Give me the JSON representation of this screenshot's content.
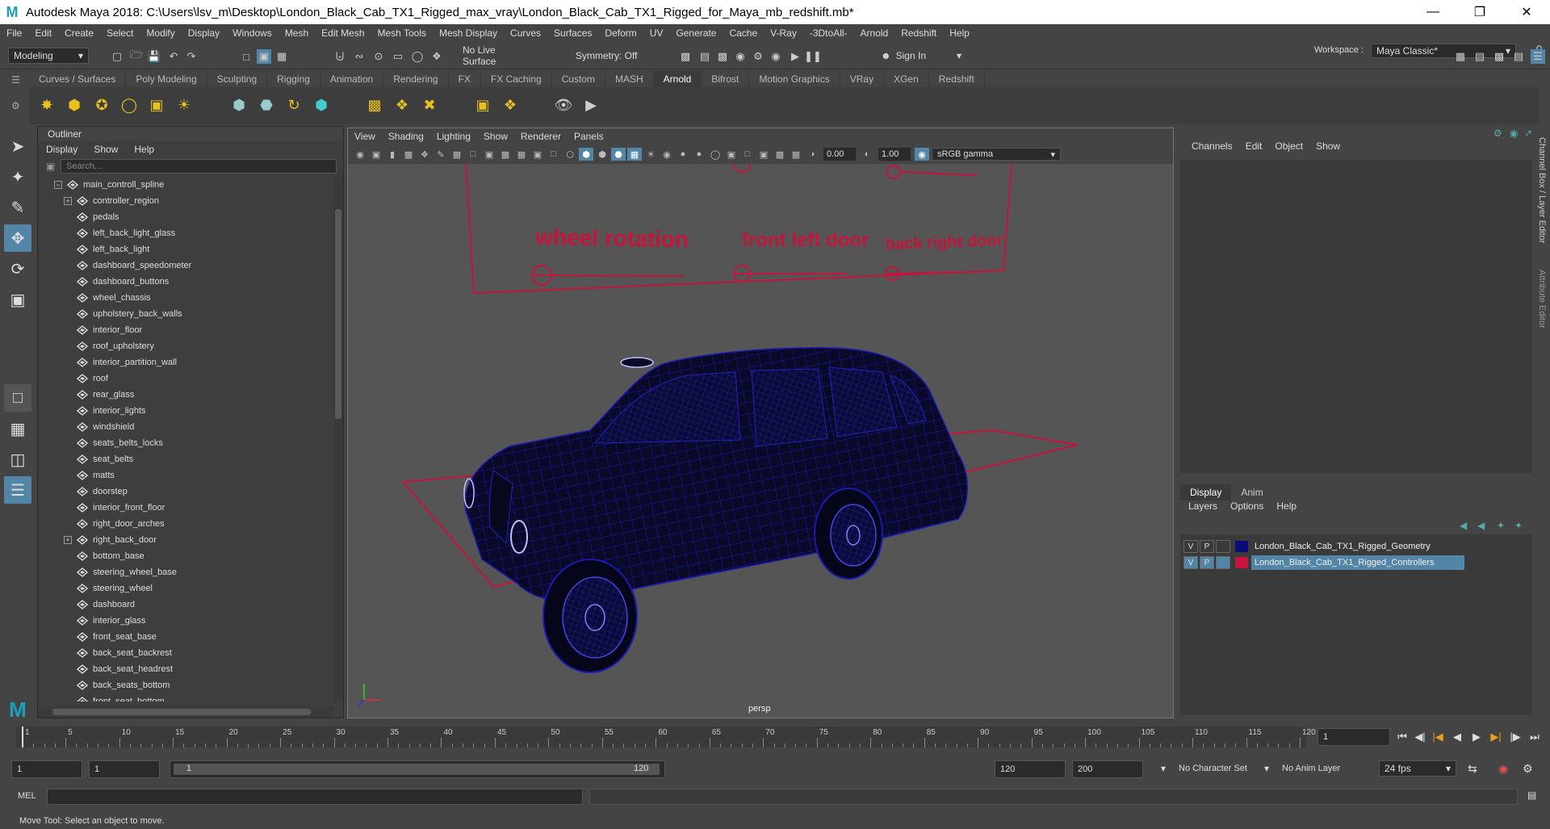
{
  "title": "Autodesk Maya 2018: C:\\Users\\lsv_m\\Desktop\\London_Black_Cab_TX1_Rigged_max_vray\\London_Black_Cab_TX1_Rigged_for_Maya_mb_redshift.mb*",
  "menus": [
    "File",
    "Edit",
    "Create",
    "Select",
    "Modify",
    "Display",
    "Windows",
    "Mesh",
    "Edit Mesh",
    "Mesh Tools",
    "Mesh Display",
    "Curves",
    "Surfaces",
    "Deform",
    "UV",
    "Generate",
    "Cache",
    "V-Ray",
    "-3DtoAll-",
    "Arnold",
    "Redshift",
    "Help"
  ],
  "status": {
    "mode": "Modeling",
    "live_surface": "No Live Surface",
    "symmetry": "Symmetry: Off",
    "sign_in": "Sign In",
    "workspace_label": "Workspace :",
    "workspace": "Maya Classic*"
  },
  "shelf_tabs": [
    {
      "label": "Curves / Surfaces",
      "active": false
    },
    {
      "label": "Poly Modeling",
      "active": false
    },
    {
      "label": "Sculpting",
      "active": false
    },
    {
      "label": "Rigging",
      "active": false
    },
    {
      "label": "Animation",
      "active": false
    },
    {
      "label": "Rendering",
      "active": false
    },
    {
      "label": "FX",
      "active": false
    },
    {
      "label": "FX Caching",
      "active": false
    },
    {
      "label": "Custom",
      "active": false
    },
    {
      "label": "MASH",
      "active": false
    },
    {
      "label": "Arnold",
      "active": true
    },
    {
      "label": "Bifrost",
      "active": false
    },
    {
      "label": "Motion Graphics",
      "active": false
    },
    {
      "label": "VRay",
      "active": false
    },
    {
      "label": "XGen",
      "active": false
    },
    {
      "label": "Redshift",
      "active": false
    }
  ],
  "outliner": {
    "title": "Outliner",
    "menu": [
      "Display",
      "Show",
      "Help"
    ],
    "search_placeholder": "Search...",
    "items": [
      {
        "label": "main_controll_spline",
        "expand": "minus",
        "indent": 0
      },
      {
        "label": "controller_region",
        "expand": "plus",
        "indent": 1
      },
      {
        "label": "pedals",
        "expand": "",
        "indent": 1
      },
      {
        "label": "left_back_light_glass",
        "expand": "",
        "indent": 1
      },
      {
        "label": "left_back_light",
        "expand": "",
        "indent": 1
      },
      {
        "label": "dashboard_speedometer",
        "expand": "",
        "indent": 1
      },
      {
        "label": "dashboard_buttons",
        "expand": "",
        "indent": 1
      },
      {
        "label": "wheel_chassis",
        "expand": "",
        "indent": 1
      },
      {
        "label": "upholstery_back_walls",
        "expand": "",
        "indent": 1
      },
      {
        "label": "interior_floor",
        "expand": "",
        "indent": 1
      },
      {
        "label": "roof_upholstery",
        "expand": "",
        "indent": 1
      },
      {
        "label": "interior_partition_wall",
        "expand": "",
        "indent": 1
      },
      {
        "label": "roof",
        "expand": "",
        "indent": 1
      },
      {
        "label": "rear_glass",
        "expand": "",
        "indent": 1
      },
      {
        "label": "interior_lights",
        "expand": "",
        "indent": 1
      },
      {
        "label": "windshield",
        "expand": "",
        "indent": 1
      },
      {
        "label": "seats_belts_locks",
        "expand": "",
        "indent": 1
      },
      {
        "label": "seat_belts",
        "expand": "",
        "indent": 1
      },
      {
        "label": "matts",
        "expand": "",
        "indent": 1
      },
      {
        "label": "doorstep",
        "expand": "",
        "indent": 1
      },
      {
        "label": "interior_front_floor",
        "expand": "",
        "indent": 1
      },
      {
        "label": "right_door_arches",
        "expand": "",
        "indent": 1
      },
      {
        "label": "right_back_door",
        "expand": "plus",
        "indent": 1
      },
      {
        "label": "bottom_base",
        "expand": "",
        "indent": 1
      },
      {
        "label": "steering_wheel_base",
        "expand": "",
        "indent": 1
      },
      {
        "label": "steering_wheel",
        "expand": "",
        "indent": 1
      },
      {
        "label": "dashboard",
        "expand": "",
        "indent": 1
      },
      {
        "label": "interior_glass",
        "expand": "",
        "indent": 1
      },
      {
        "label": "front_seat_base",
        "expand": "",
        "indent": 1
      },
      {
        "label": "back_seat_backrest",
        "expand": "",
        "indent": 1
      },
      {
        "label": "back_seat_headrest",
        "expand": "",
        "indent": 1
      },
      {
        "label": "back_seats_bottom",
        "expand": "",
        "indent": 1
      },
      {
        "label": "front_seat_bottom",
        "expand": "",
        "indent": 1
      }
    ]
  },
  "viewport": {
    "menu": [
      "View",
      "Shading",
      "Lighting",
      "Show",
      "Renderer",
      "Panels"
    ],
    "exposure": "0.00",
    "gamma": "1.00",
    "color_space": "sRGB gamma",
    "camera": "persp",
    "labels": [
      "wheel rotation",
      "front left door",
      "back right door"
    ]
  },
  "channel_box": {
    "menu": [
      "Channels",
      "Edit",
      "Object",
      "Show"
    ],
    "layer_tabs": [
      {
        "label": "Display",
        "active": true
      },
      {
        "label": "Anim",
        "active": false
      }
    ],
    "layer_menu": [
      "Layers",
      "Options",
      "Help"
    ],
    "layers": [
      {
        "v": "V",
        "p": "P",
        "color": "#0b0b7a",
        "name": "London_Black_Cab_TX1_Rigged_Geometry",
        "selected": false
      },
      {
        "v": "V",
        "p": "P",
        "color": "#c4153c",
        "name": "London_Black_Cab_TX1_Rigged_Controllers",
        "selected": true
      }
    ],
    "side_tabs": [
      "Channel Box / Layer Editor",
      "Attribute Editor"
    ]
  },
  "timeline": {
    "ticks": [
      1,
      5,
      10,
      15,
      20,
      25,
      30,
      35,
      40,
      45,
      50,
      55,
      60,
      65,
      70,
      75,
      80,
      85,
      90,
      95,
      100,
      105,
      110,
      115,
      120
    ],
    "current_frame": "1"
  },
  "range": {
    "start": "1",
    "playback_start": "1",
    "slider_start": "1",
    "slider_end": "120",
    "playback_end": "120",
    "end": "200",
    "character_set": "No Character Set",
    "anim_layer": "No Anim Layer",
    "fps": "24 fps"
  },
  "cmdline": {
    "label": "MEL"
  },
  "help_line": "Move Tool: Select an object to move.",
  "colors": {
    "accent": "#5285a6",
    "controller": "#c4153c",
    "wireframe": "#1a1ab0"
  }
}
